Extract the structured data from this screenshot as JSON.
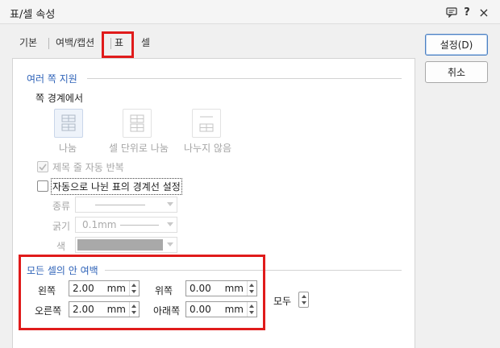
{
  "window": {
    "title": "표/셀 속성",
    "help_glyph": "?",
    "close_glyph": "×"
  },
  "tabs": [
    {
      "label": "기본"
    },
    {
      "label": "여백/캡션"
    },
    {
      "label": "표",
      "active": true
    },
    {
      "label": "셀"
    }
  ],
  "buttons": {
    "ok": "설정(D)",
    "cancel": "취소"
  },
  "multipage": {
    "group_title": "여러 쪽 지원",
    "boundary_label": "쪽 경계에서",
    "options": [
      {
        "label": "나눔",
        "icon": "table-split-icon",
        "selected": true
      },
      {
        "label": "셀 단위로 나눔",
        "icon": "table-cell-split-icon",
        "selected": false
      },
      {
        "label": "나누지 않음",
        "icon": "table-no-split-icon",
        "selected": false
      }
    ],
    "repeat_title": {
      "label": "제목 줄 자동 반복",
      "checked": true,
      "disabled": true
    },
    "auto_border": {
      "label": "자동으로 나뉜 표의 경계선 설정",
      "checked": false
    },
    "line_type_label": "종류",
    "line_width_label": "굵기",
    "line_width_value": "0.1mm",
    "color_label": "색"
  },
  "cell_margin": {
    "group_title": "모든 셀의 안 여백",
    "left": {
      "label": "왼쪽",
      "value": "2.00",
      "unit": "mm"
    },
    "right": {
      "label": "오른쪽",
      "value": "2.00",
      "unit": "mm"
    },
    "top": {
      "label": "위쪽",
      "value": "0.00",
      "unit": "mm"
    },
    "bottom": {
      "label": "아래쪽",
      "value": "0.00",
      "unit": "mm"
    },
    "all_label": "모두"
  }
}
